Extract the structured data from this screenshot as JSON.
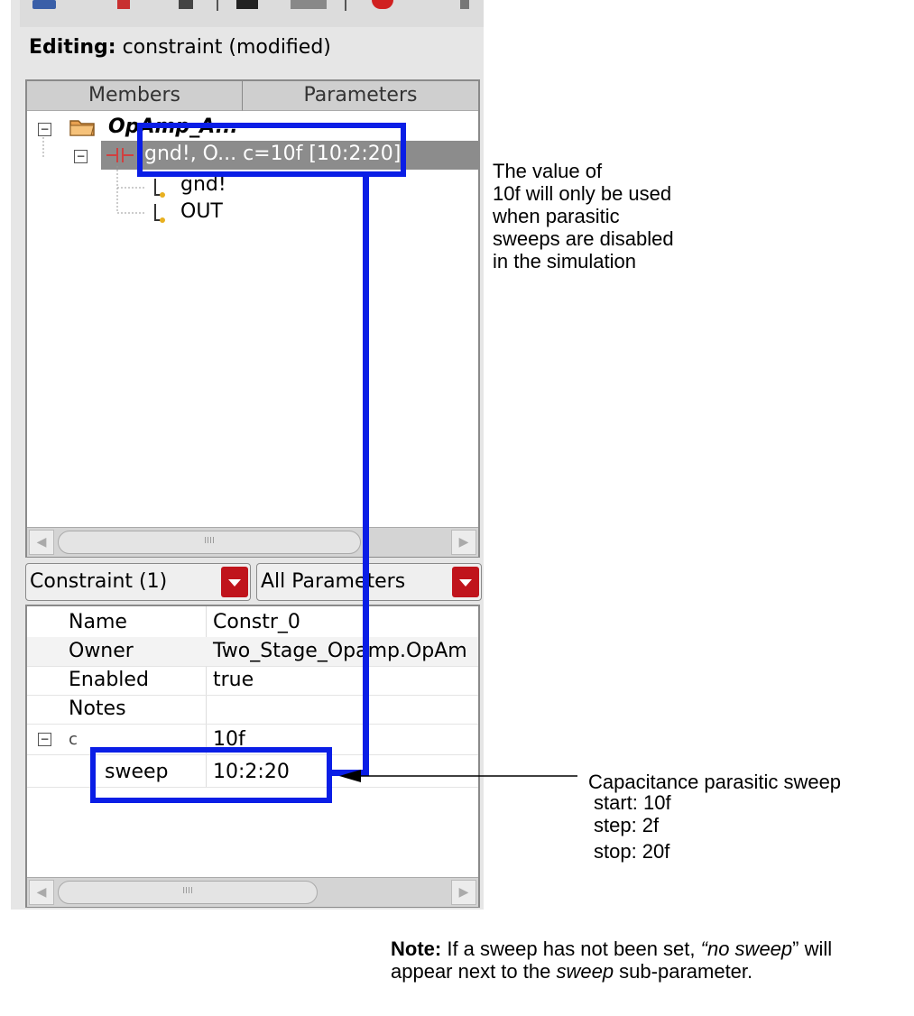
{
  "editing": {
    "label": "Editing:",
    "value": " constraint (modified)"
  },
  "tree": {
    "columns": [
      "Members",
      "Parameters"
    ],
    "root_label": "OpAmp_A...",
    "selected_label": "gnd!, O...  c=10f [10:2:20]",
    "children": [
      "gnd!",
      "OUT"
    ],
    "expander_glyph": "−",
    "scroll_glyph": "IIII"
  },
  "filters": {
    "constraint_combo": "Constraint (1)",
    "params_combo": "All Parameters"
  },
  "properties": {
    "rows": [
      {
        "name": "Name",
        "value": "Constr_0"
      },
      {
        "name": "Owner",
        "value": "Two_Stage_Opamp.OpAm"
      },
      {
        "name": "Enabled",
        "value": "true"
      },
      {
        "name": "Notes",
        "value": ""
      }
    ],
    "param": {
      "name": "c",
      "value": "10f"
    },
    "sub_param": {
      "name": "sweep",
      "value": "10:2:20"
    }
  },
  "annotations": {
    "value_note": [
      "The value of",
      "10f will only be used",
      "when parasitic",
      "sweeps are disabled",
      "in the simulation"
    ],
    "sweep_title": "Capacitance parasitic sweep",
    "sweep_start": "start: 10f",
    "sweep_step": "step: 2f",
    "sweep_stop": "stop: 20f",
    "note_bold": "Note:",
    "note_part1": " If a sweep has not been set, ",
    "note_italic": "“no sweep",
    "note_part2": "” will",
    "note_line2a": "appear next to the ",
    "note_line2_italic": "sweep",
    "note_line2b": " sub-parameter."
  },
  "colors": {
    "highlight": "#0a1ee6",
    "combo_button": "#c0141c"
  },
  "icons": [
    "folder-icon",
    "capacitor-icon",
    "net-icon",
    "dropdown-arrow-icon",
    "scroll-left-icon",
    "scroll-right-icon"
  ]
}
